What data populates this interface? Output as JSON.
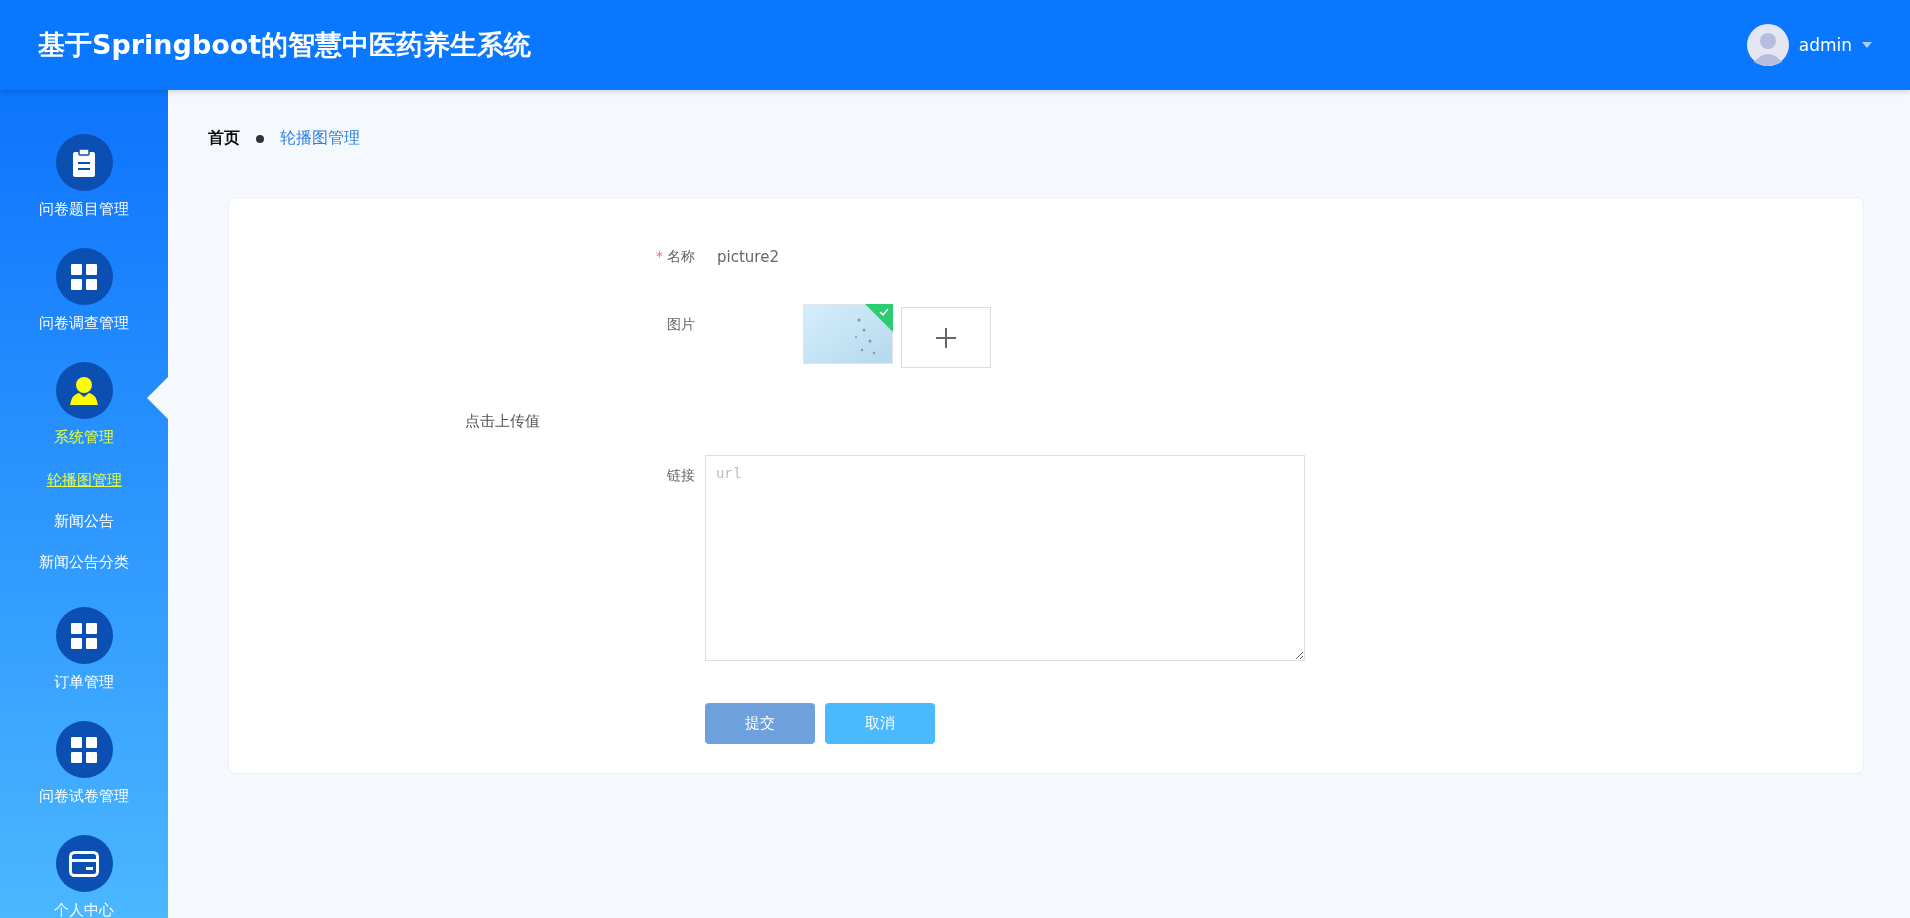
{
  "header": {
    "title": "基于Springboot的智慧中医药养生系统",
    "user": "admin"
  },
  "sidebar": {
    "items": [
      {
        "label": "问卷题目管理",
        "selected": false
      },
      {
        "label": "问卷调查管理",
        "selected": false
      },
      {
        "label": "系统管理",
        "selected": true,
        "children": [
          {
            "label": "轮播图管理",
            "selected": true
          },
          {
            "label": "新闻公告",
            "selected": false
          },
          {
            "label": "新闻公告分类",
            "selected": false
          }
        ]
      },
      {
        "label": "订单管理",
        "selected": false
      },
      {
        "label": "问卷试卷管理",
        "selected": false
      },
      {
        "label": "个人中心",
        "selected": false
      }
    ]
  },
  "breadcrumb": [
    "首页",
    "轮播图管理"
  ],
  "form": {
    "name": {
      "label": "名称",
      "required_mark": "*",
      "value": "picture2"
    },
    "image": {
      "label": "图片",
      "uploaded": true,
      "hint": "点击上传值"
    },
    "link": {
      "label": "链接",
      "placeholder": "url"
    },
    "buttons": [
      {
        "label": "提交",
        "kind": "submit"
      },
      {
        "label": "取消",
        "kind": "cancel"
      }
    ]
  }
}
